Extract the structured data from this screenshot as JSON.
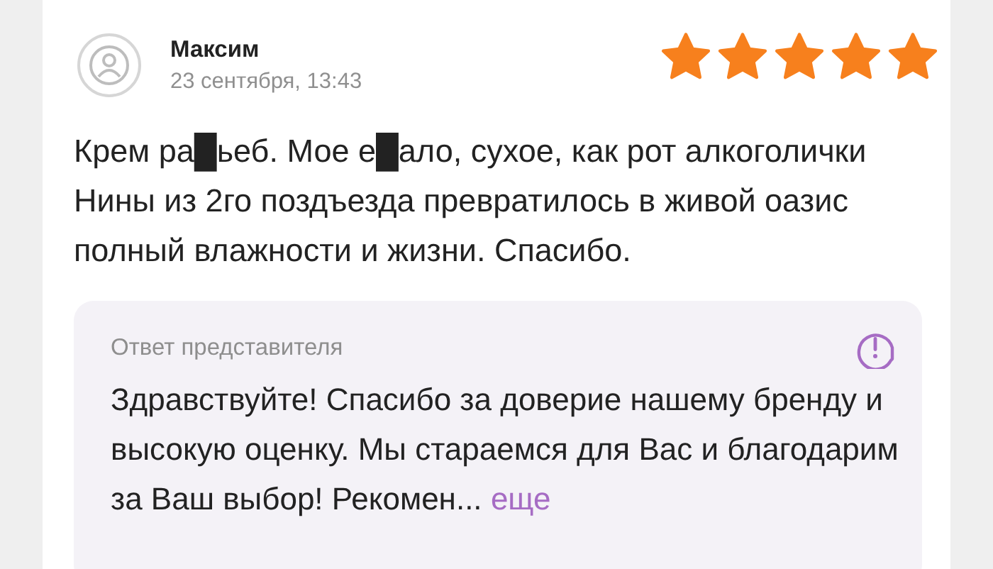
{
  "review": {
    "author": "Максим",
    "date": "23 сентября, 13:43",
    "stars": 5,
    "text": "Крем ра█ьеб. Мое е█ало, сухое, как рот алкоголички Нины из 2го поздъезда превратилось в живой оазис полный влажности и жизни. Спасибо."
  },
  "reply": {
    "title": "Ответ представителя",
    "text": "Здравствуйте! Спасибо за доверие нашему бренду и высокую оценку. Мы стараемся для Вас и благодарим за Ваш выбор! Рекомен...",
    "more": "еще"
  }
}
